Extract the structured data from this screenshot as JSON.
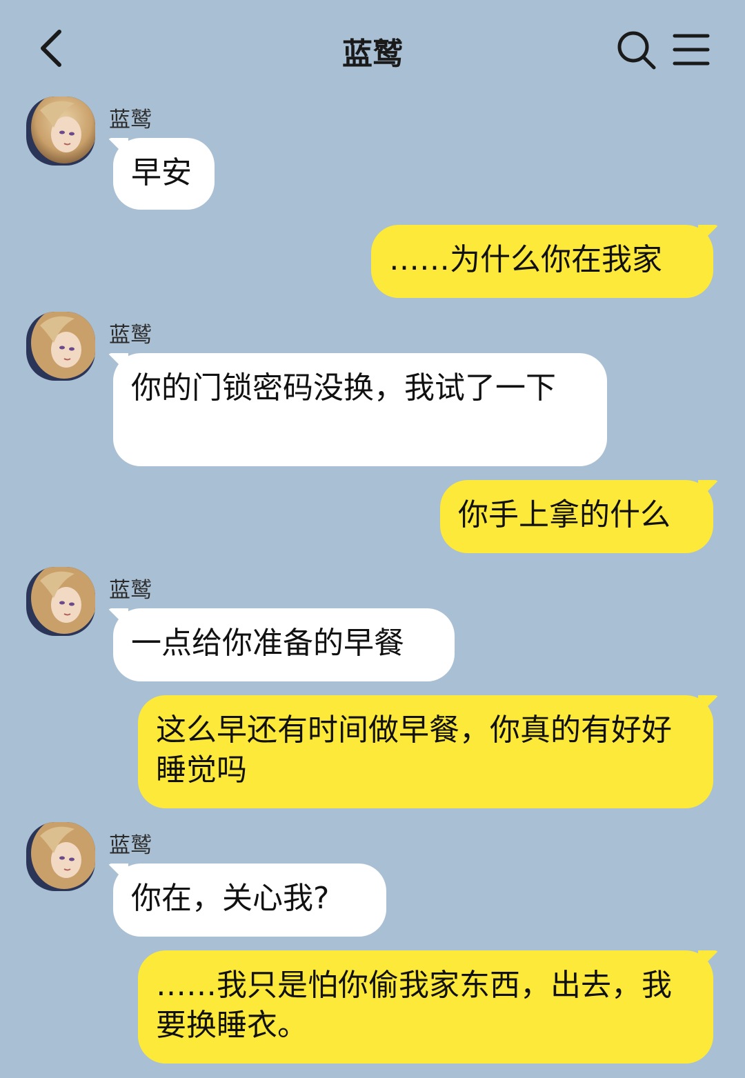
{
  "header": {
    "title": "蓝鹫"
  },
  "contact": {
    "name": "蓝鹫"
  },
  "messages": [
    {
      "side": "in",
      "sender": "蓝鹫",
      "text": "早安"
    },
    {
      "side": "out",
      "text": "……为什么你在我家"
    },
    {
      "side": "in",
      "sender": "蓝鹫",
      "text": "你的门锁密码没换，我试了一下"
    },
    {
      "side": "out",
      "text": "你手上拿的什么"
    },
    {
      "side": "in",
      "sender": "蓝鹫",
      "text": "一点给你准备的早餐"
    },
    {
      "side": "out",
      "text": "这么早还有时间做早餐，你真的有好好睡觉吗"
    },
    {
      "side": "in",
      "sender": "蓝鹫",
      "text": "你在，关心我?"
    },
    {
      "side": "out",
      "text": "……我只是怕你偷我家东西，出去，我要换睡衣。"
    }
  ],
  "colors": {
    "background": "#a9bfd3",
    "incoming": "#ffffff",
    "outgoing": "#fde93a"
  },
  "icons": {
    "back": "chevron-left-icon",
    "search": "search-icon",
    "menu": "menu-icon"
  }
}
